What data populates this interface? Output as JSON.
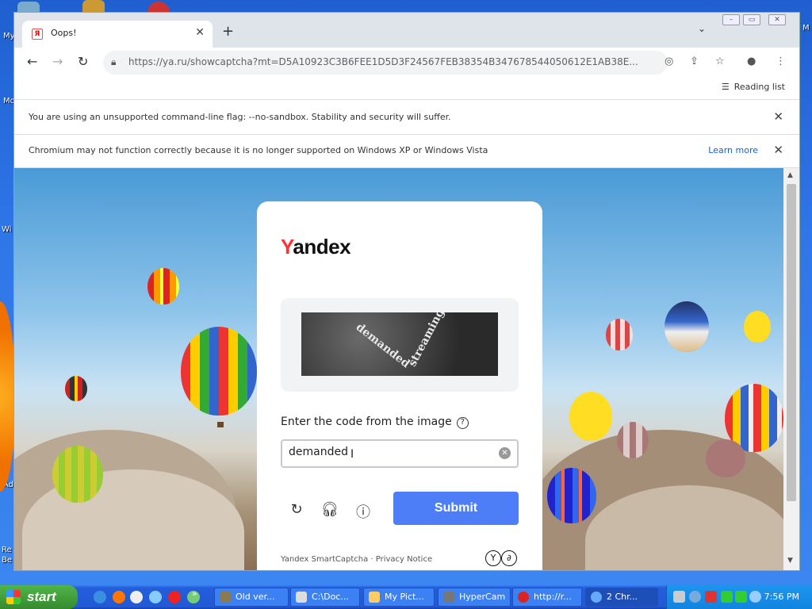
{
  "desktop": {
    "labels": [
      "My",
      "Mo",
      "Wi",
      "Ad",
      "Re",
      "Be"
    ]
  },
  "browser": {
    "tab": {
      "favicon": "Я",
      "title": "Oops!"
    },
    "url": "https://ya.ru/showcaptcha?mt=D5A10923C3B6FEE1D5D3F24567FEB38354B347678544050612E1AB38E...",
    "reading_list": "Reading list",
    "infobar1": "You are using an unsupported command-line flag: --no-sandbox. Stability and security will suffer.",
    "infobar2": "Chromium may not function correctly because it is no longer supported on Windows XP or Windows Vista",
    "learn_more": "Learn more"
  },
  "captcha": {
    "logo_y": "Y",
    "logo_rest": "andex",
    "image_words": [
      "demanded",
      "streaming"
    ],
    "prompt": "Enter the code from the image",
    "input_value": "demanded",
    "submit": "Submit",
    "footer_brand": "Yandex SmartCaptcha",
    "footer_sep": " · ",
    "footer_privacy": "Privacy Notice"
  },
  "taskbar": {
    "start": "start",
    "buttons": [
      "Old ver...",
      "C:\\Doc...",
      "My Pict...",
      "HyperCam",
      "http://r...",
      "2 Chr..."
    ],
    "clock": "7:56 PM"
  },
  "colors": {
    "submit": "#4d7ef7",
    "yandex_red": "#ff3333",
    "taskbar": "#245edb"
  }
}
